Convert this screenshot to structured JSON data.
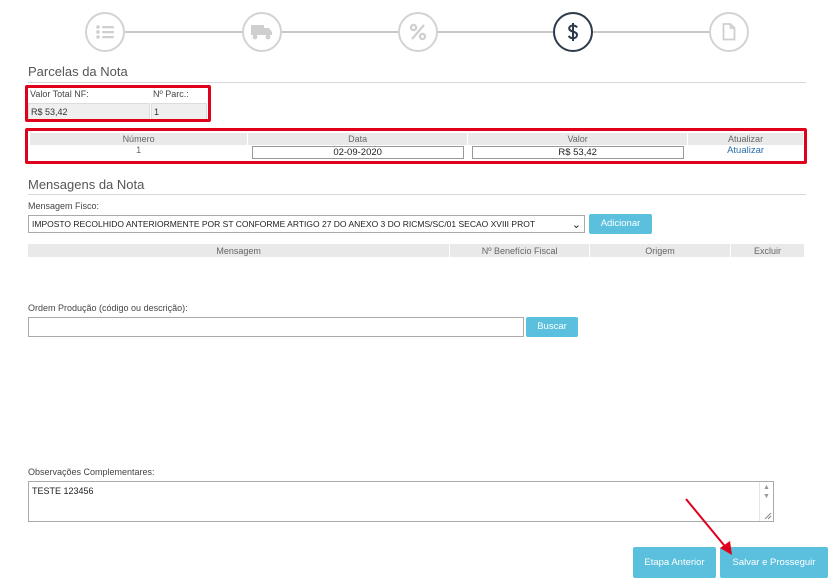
{
  "stepper": {
    "steps": [
      {
        "icon": "list-icon",
        "active": false
      },
      {
        "icon": "truck-icon",
        "active": false
      },
      {
        "icon": "percent-icon",
        "active": false
      },
      {
        "icon": "dollar-icon",
        "active": true
      },
      {
        "icon": "document-icon",
        "active": false
      }
    ]
  },
  "parcelas": {
    "title": "Parcelas da Nota",
    "total_label": "Valor Total NF:",
    "total_value": "R$ 53,42",
    "nparc_label": "Nº Parc.:",
    "nparc_value": "1",
    "columns": [
      "Número",
      "Data",
      "Valor",
      "Atualizar"
    ],
    "rows": [
      {
        "numero": "1",
        "data": "02-09-2020",
        "valor": "R$ 53,42",
        "action": "Atualizar"
      }
    ]
  },
  "mensagens": {
    "title": "Mensagens da Nota",
    "fisco_label": "Mensagem Fisco:",
    "fisco_selected": "IMPOSTO RECOLHIDO ANTERIORMENTE POR ST CONFORME ARTIGO 27 DO ANEXO 3 DO RICMS/SC/01 SECAO XVIII PROT",
    "add_label": "Adicionar",
    "columns": [
      "Mensagem",
      "Nº Benefício Fiscal",
      "Origem",
      "Excluir"
    ]
  },
  "ordem": {
    "label": "Ordem Produção (código ou descrição):",
    "value": "",
    "search_label": "Buscar"
  },
  "observacoes": {
    "label": "Observações Complementares:",
    "value": "TESTE 123456"
  },
  "footer": {
    "prev_label": "Etapa Anterior",
    "next_label": "Salvar e Prosseguir"
  },
  "colors": {
    "accent": "#5bc0de",
    "highlight": "#e0001b",
    "step_active": "#2b3a4a",
    "step_inactive": "#d3d3d3"
  }
}
